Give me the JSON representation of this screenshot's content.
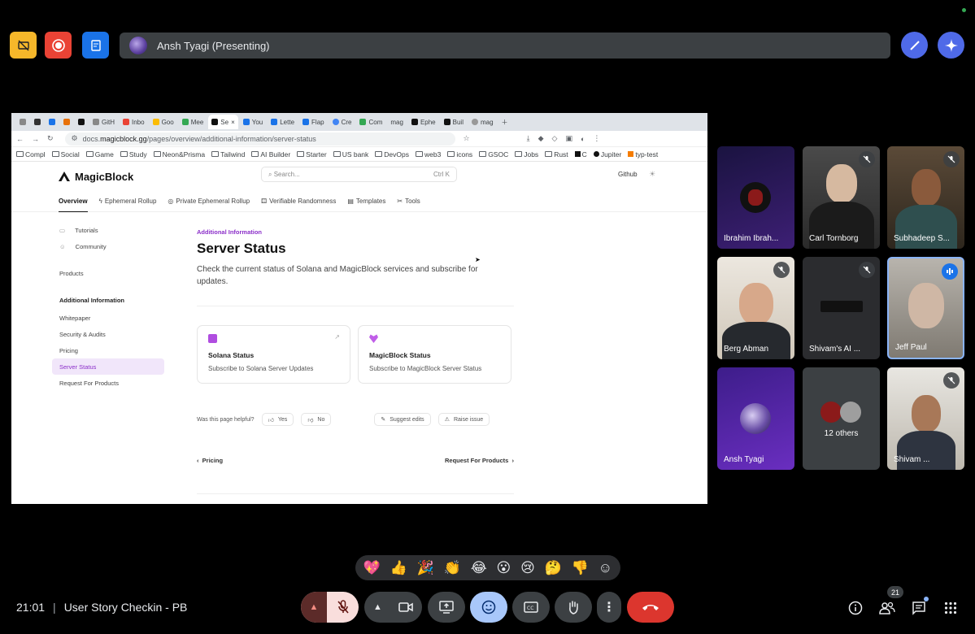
{
  "meet": {
    "presenter": "Ansh Tyagi (Presenting)",
    "time": "21:01",
    "separator": "|",
    "meeting_title": "User Story Checkin - PB",
    "participants_badge": "21"
  },
  "browser": {
    "tabs": [
      "GitH",
      "Inbo",
      "Goo",
      "Mee",
      "Se",
      "You",
      "Lette",
      "Flap",
      "Cre",
      "Com",
      "mag",
      "Ephe",
      "Buil",
      "mag"
    ],
    "url_prefix": "docs.",
    "url_domain": "magicblock.gg",
    "url_path": "/pages/overview/additional-information/server-status",
    "bookmarks": [
      "Compl",
      "Social",
      "Game",
      "Study",
      "Neon&Prisma",
      "Tailwind",
      "AI Builder",
      "Starter",
      "US bank",
      "DevOps",
      "web3",
      "icons",
      "GSOC",
      "Jobs",
      "Rust",
      "C",
      "Jupiter",
      "typ-test"
    ]
  },
  "site": {
    "logo": "MagicBlock",
    "search_placeholder": "Search...",
    "search_shortcut": "Ctrl K",
    "github": "Github",
    "nav": [
      "Overview",
      "Ephemeral Rollup",
      "Private Ephemeral Rollup",
      "Verifiable Randomness",
      "Templates",
      "Tools"
    ],
    "sidebar_top": [
      "Tutorials",
      "Community"
    ],
    "sidebar_products": "Products",
    "sidebar_section": "Additional Information",
    "sidebar_items": [
      "Whitepaper",
      "Security & Audits",
      "Pricing",
      "Server Status",
      "Request For Products"
    ],
    "eyebrow": "Additional Information",
    "title": "Server Status",
    "lead": "Check the current status of Solana and MagicBlock services and subscribe for updates.",
    "cards": [
      {
        "title": "Solana Status",
        "sub": "Subscribe to Solana Server Updates"
      },
      {
        "title": "MagicBlock Status",
        "sub": "Subscribe to MagicBlock Server Status"
      }
    ],
    "helpful_q": "Was this page helpful?",
    "yes": "Yes",
    "no": "No",
    "suggest": "Suggest edits",
    "raise": "Raise issue",
    "prev": "Pricing",
    "next": "Request For Products"
  },
  "participants": [
    {
      "name": "Ibrahim Ibrah..."
    },
    {
      "name": "Carl Tornborg"
    },
    {
      "name": "Subhadeep S..."
    },
    {
      "name": "Berg Abman"
    },
    {
      "name": "Shivam's AI ..."
    },
    {
      "name": "Jeff Paul"
    },
    {
      "name": "Ansh Tyagi"
    },
    {
      "name": "12 others"
    },
    {
      "name": "Shivam ..."
    }
  ],
  "reactions": [
    "💖",
    "👍",
    "🎉",
    "👏",
    "😂",
    "😮",
    "😢",
    "🤔",
    "👎",
    "☺"
  ]
}
